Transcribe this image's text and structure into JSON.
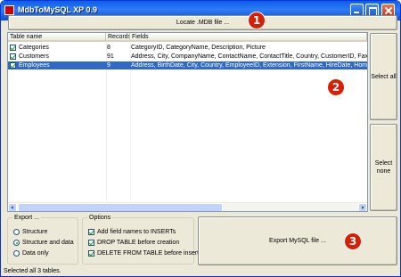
{
  "window": {
    "title": "MdbToMySQL XP 0.9",
    "minimize_label": "",
    "maximize_label": "",
    "close_label": ""
  },
  "toolbar": {
    "locate_label": "Locate .MDB file ...",
    "select_all_label": "Select all",
    "select_none_label": "Select none",
    "export_label": "Export MySQL file ..."
  },
  "table": {
    "columns": [
      "Table name",
      "Records",
      "Fields"
    ],
    "rows": [
      {
        "checked": true,
        "name": "Categories",
        "records": "8",
        "fields": "CategoryID, CategoryName, Description, Picture",
        "selected": false
      },
      {
        "checked": true,
        "name": "Customers",
        "records": "91",
        "fields": "Address, City, CompanyName, ContactName, ContactTitle, Country, CustomerID, Fax, Phone, Pos",
        "selected": false
      },
      {
        "checked": true,
        "name": "Employees",
        "records": "9",
        "fields": "Address, BirthDate, City, Country, EmployeeID, Extension, FirstName, HireDate, HomePhone, Last",
        "selected": true
      }
    ]
  },
  "export_group": {
    "title": "Export ...",
    "options": [
      {
        "label": "Structure",
        "selected": false
      },
      {
        "label": "Structure and data",
        "selected": true
      },
      {
        "label": "Data only",
        "selected": false
      }
    ]
  },
  "options_group": {
    "title": "Options",
    "options": [
      {
        "label": "Add field names to INSERTs",
        "checked": true
      },
      {
        "label": "DROP TABLE before creation",
        "checked": true
      },
      {
        "label": "DELETE FROM TABLE before insert",
        "checked": true
      }
    ]
  },
  "status": {
    "text": "Selected all 3 tables."
  },
  "markers": [
    "1",
    "2",
    "3"
  ],
  "colors": {
    "titlebar": "#0a5fe8",
    "selection": "#316ac5",
    "marker": "#d81e05",
    "face": "#ece9d8"
  }
}
